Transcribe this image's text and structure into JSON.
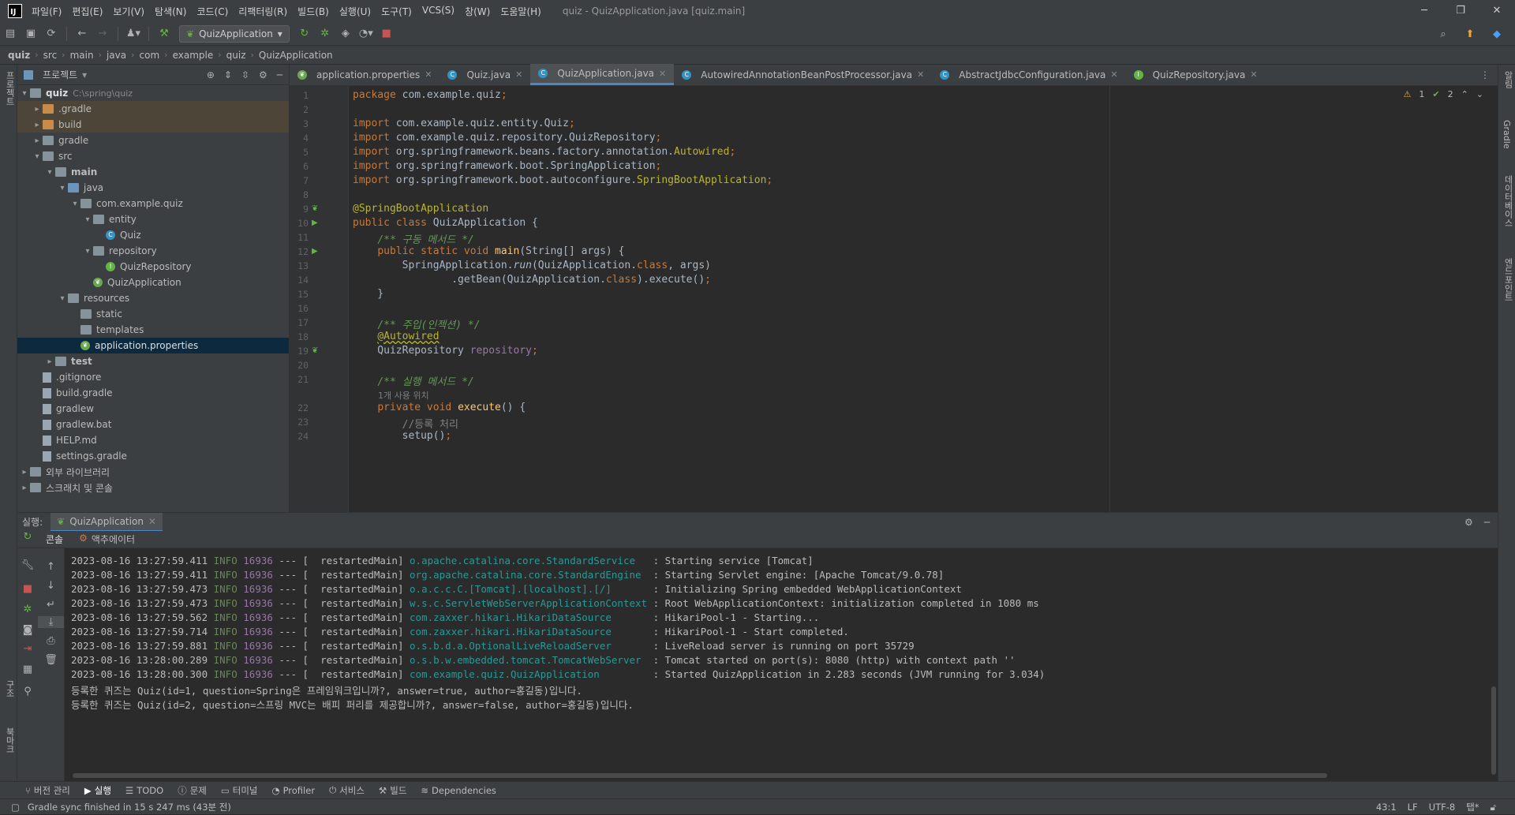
{
  "window": {
    "title": "quiz - QuizApplication.java [quiz.main]"
  },
  "menu": [
    "파일(F)",
    "편집(E)",
    "보기(V)",
    "탐색(N)",
    "코드(C)",
    "리팩터링(R)",
    "빌드(B)",
    "실행(U)",
    "도구(T)",
    "VCS(S)",
    "창(W)",
    "도움말(H)"
  ],
  "toolbar": {
    "run_config": "QuizApplication"
  },
  "breadcrumb": [
    "quiz",
    "src",
    "main",
    "java",
    "com",
    "example",
    "quiz",
    "QuizApplication"
  ],
  "project": {
    "title": "프로젝트",
    "root_name": "quiz",
    "root_path": "C:\\spring\\quiz",
    "items": [
      {
        "label": ".gradle",
        "depth": 1,
        "type": "folder-o",
        "arrow": "▸",
        "hl": true
      },
      {
        "label": "build",
        "depth": 1,
        "type": "folder-o",
        "arrow": "▸",
        "hl": true
      },
      {
        "label": "gradle",
        "depth": 1,
        "type": "folder",
        "arrow": "▸"
      },
      {
        "label": "src",
        "depth": 1,
        "type": "folder",
        "arrow": "▾"
      },
      {
        "label": "main",
        "depth": 2,
        "type": "folder",
        "arrow": "▾",
        "bold": true
      },
      {
        "label": "java",
        "depth": 3,
        "type": "folder-b",
        "arrow": "▾"
      },
      {
        "label": "com.example.quiz",
        "depth": 4,
        "type": "folder",
        "arrow": "▾"
      },
      {
        "label": "entity",
        "depth": 5,
        "type": "folder",
        "arrow": "▾"
      },
      {
        "label": "Quiz",
        "depth": 6,
        "type": "cls",
        "arrow": ""
      },
      {
        "label": "repository",
        "depth": 5,
        "type": "folder",
        "arrow": "▾"
      },
      {
        "label": "QuizRepository",
        "depth": 6,
        "type": "int",
        "arrow": ""
      },
      {
        "label": "QuizApplication",
        "depth": 5,
        "type": "spring",
        "arrow": ""
      },
      {
        "label": "resources",
        "depth": 3,
        "type": "folder",
        "arrow": "▾"
      },
      {
        "label": "static",
        "depth": 4,
        "type": "folder",
        "arrow": ""
      },
      {
        "label": "templates",
        "depth": 4,
        "type": "folder",
        "arrow": ""
      },
      {
        "label": "application.properties",
        "depth": 4,
        "type": "spring",
        "arrow": "",
        "sel": true
      },
      {
        "label": "test",
        "depth": 2,
        "type": "folder",
        "arrow": "▸",
        "bold": true
      },
      {
        "label": ".gitignore",
        "depth": 1,
        "type": "file",
        "arrow": ""
      },
      {
        "label": "build.gradle",
        "depth": 1,
        "type": "file",
        "arrow": ""
      },
      {
        "label": "gradlew",
        "depth": 1,
        "type": "file",
        "arrow": ""
      },
      {
        "label": "gradlew.bat",
        "depth": 1,
        "type": "file",
        "arrow": ""
      },
      {
        "label": "HELP.md",
        "depth": 1,
        "type": "file",
        "arrow": ""
      },
      {
        "label": "settings.gradle",
        "depth": 1,
        "type": "file",
        "arrow": ""
      },
      {
        "label": "외부 라이브러리",
        "depth": 0,
        "type": "folder",
        "arrow": "▸"
      },
      {
        "label": "스크래치 및 콘솔",
        "depth": 0,
        "type": "folder",
        "arrow": "▸"
      }
    ]
  },
  "tabs": [
    {
      "label": "application.properties",
      "active": false
    },
    {
      "label": "Quiz.java",
      "active": false
    },
    {
      "label": "QuizApplication.java",
      "active": true
    },
    {
      "label": "AutowiredAnnotationBeanPostProcessor.java",
      "active": false
    },
    {
      "label": "AbstractJdbcConfiguration.java",
      "active": false
    },
    {
      "label": "QuizRepository.java",
      "active": false
    }
  ],
  "inspection": {
    "warnings": "1",
    "ok": "2"
  },
  "code": {
    "line_numbers": [
      "1",
      "2",
      "3",
      "4",
      "5",
      "6",
      "7",
      "8",
      "9",
      "10",
      "11",
      "12",
      "13",
      "14",
      "15",
      "16",
      "17",
      "18",
      "19",
      "20",
      "21",
      "22",
      "23",
      "24"
    ],
    "inlay_hint": "1개 사용 위치"
  },
  "run": {
    "label": "실행:",
    "config_tab": "QuizApplication",
    "subtabs": [
      "콘솔",
      "액추에이터"
    ]
  },
  "console_lines": [
    {
      "ts": "2023-08-16 13:27:59.411",
      "level": "INFO",
      "pid": "16936",
      "thread": "[  restartedMain]",
      "logger": "o.apache.catalina.core.StandardService  ",
      "msg": ": Starting service [Tomcat]"
    },
    {
      "ts": "2023-08-16 13:27:59.411",
      "level": "INFO",
      "pid": "16936",
      "thread": "[  restartedMain]",
      "logger": "org.apache.catalina.core.StandardEngine ",
      "msg": ": Starting Servlet engine: [Apache Tomcat/9.0.78]"
    },
    {
      "ts": "2023-08-16 13:27:59.473",
      "level": "INFO",
      "pid": "16936",
      "thread": "[  restartedMain]",
      "logger": "o.a.c.c.C.[Tomcat].[localhost].[/]      ",
      "msg": ": Initializing Spring embedded WebApplicationContext"
    },
    {
      "ts": "2023-08-16 13:27:59.473",
      "level": "INFO",
      "pid": "16936",
      "thread": "[  restartedMain]",
      "logger": "w.s.c.ServletWebServerApplicationContext",
      "msg": ": Root WebApplicationContext: initialization completed in 1080 ms"
    },
    {
      "ts": "2023-08-16 13:27:59.562",
      "level": "INFO",
      "pid": "16936",
      "thread": "[  restartedMain]",
      "logger": "com.zaxxer.hikari.HikariDataSource      ",
      "msg": ": HikariPool-1 - Starting..."
    },
    {
      "ts": "2023-08-16 13:27:59.714",
      "level": "INFO",
      "pid": "16936",
      "thread": "[  restartedMain]",
      "logger": "com.zaxxer.hikari.HikariDataSource      ",
      "msg": ": HikariPool-1 - Start completed."
    },
    {
      "ts": "2023-08-16 13:27:59.881",
      "level": "INFO",
      "pid": "16936",
      "thread": "[  restartedMain]",
      "logger": "o.s.b.d.a.OptionalLiveReloadServer      ",
      "msg": ": LiveReload server is running on port 35729"
    },
    {
      "ts": "2023-08-16 13:28:00.289",
      "level": "INFO",
      "pid": "16936",
      "thread": "[  restartedMain]",
      "logger": "o.s.b.w.embedded.tomcat.TomcatWebServer ",
      "msg": ": Tomcat started on port(s): 8080 (http) with context path ''"
    },
    {
      "ts": "2023-08-16 13:28:00.300",
      "level": "INFO",
      "pid": "16936",
      "thread": "[  restartedMain]",
      "logger": "com.example.quiz.QuizApplication        ",
      "msg": ": Started QuizApplication in 2.283 seconds (JVM running for 3.034)"
    }
  ],
  "console_output": [
    "등록한 퀴즈는 Quiz(id=1, question=Spring은 프레임워크입니까?, answer=true, author=홍길동)입니다.",
    "등록한 퀴즈는 Quiz(id=2, question=스프링 MVC는 배피 퍼리를 제공합니까?, answer=false, author=홍길동)입니다."
  ],
  "bottom_tools": [
    "버전 관리",
    "실행",
    "TODO",
    "문제",
    "터미널",
    "Profiler",
    "서비스",
    "빌드",
    "Dependencies"
  ],
  "status": {
    "message": "Gradle sync finished in 15 s 247 ms (43분 전)",
    "position": "43:1",
    "line_sep": "LF",
    "encoding": "UTF-8",
    "indent": "탭*"
  },
  "left_strip_labels": [
    "프로젝트",
    "구조",
    "북마크"
  ],
  "right_strip_labels": [
    "알림",
    "Gradle",
    "데이터베이스",
    "엔드포인트"
  ]
}
